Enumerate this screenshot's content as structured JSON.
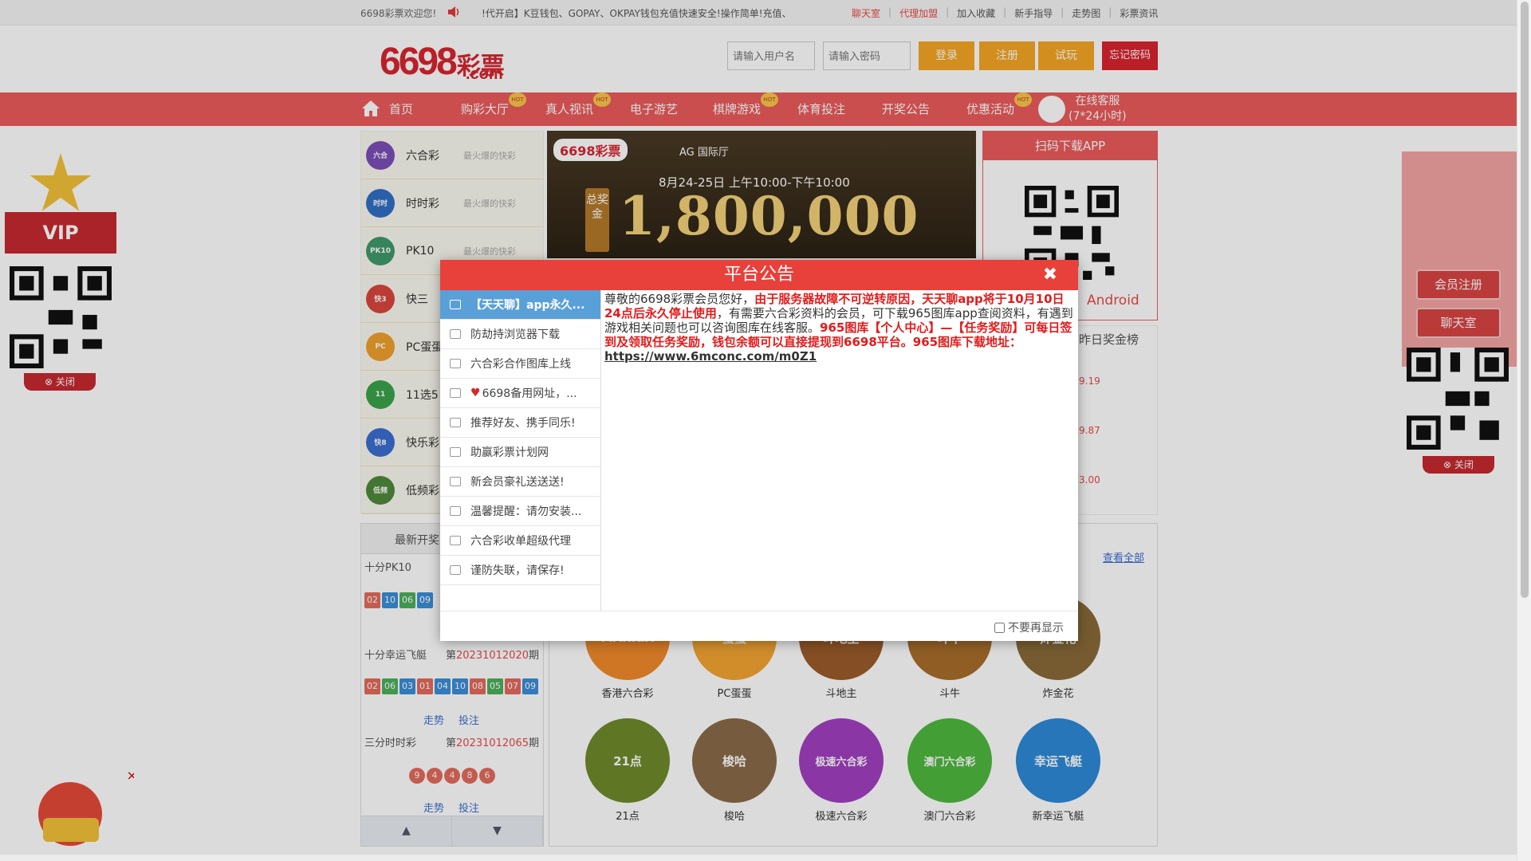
{
  "topbar": {
    "welcome": "6698彩票欢迎您!",
    "marquee": "!代开启】K豆钱包、GOPAY、OKPAY钱包充值快速安全!操作简单!充值、",
    "links": [
      "聊天室",
      "代理加盟",
      "加入收藏",
      "新手指导",
      "走势图",
      "彩票资讯"
    ]
  },
  "header": {
    "logo_number": "6698",
    "logo_text": "彩票",
    "logo_domain": ".com",
    "username_placeholder": "请输入用户名",
    "password_placeholder": "请输入密码",
    "login": "登录",
    "register": "注册",
    "trial": "试玩",
    "forgot": "忘记密码"
  },
  "nav": {
    "items": [
      "首页",
      "购彩大厅",
      "真人视讯",
      "电子游艺",
      "棋牌游戏",
      "体育投注",
      "开奖公告",
      "优惠活动"
    ],
    "hot_badge": "HOT",
    "service_line1": "在线客服",
    "service_line2": "(7*24小时)"
  },
  "lotteries": [
    {
      "name": "六合彩",
      "desc": "最火爆的快彩",
      "icon": "六合",
      "color": "#7b4fb8"
    },
    {
      "name": "时时彩",
      "desc": "最火爆的快彩",
      "icon": "时时",
      "color": "#2f6fc4"
    },
    {
      "name": "PK10",
      "desc": "最火爆的快彩",
      "icon": "PK10",
      "color": "#3f9a6a"
    },
    {
      "name": "快三",
      "desc": "",
      "icon": "快3",
      "color": "#d9463e"
    },
    {
      "name": "PC蛋蛋",
      "desc": "",
      "icon": "PC",
      "color": "#f0a12a"
    },
    {
      "name": "11选5",
      "desc": "",
      "icon": "11",
      "color": "#3aa44a"
    },
    {
      "name": "快乐彩",
      "desc": "",
      "icon": "快8",
      "color": "#3b6fd2"
    },
    {
      "name": "低频彩",
      "desc": "",
      "icon": "低频",
      "color": "#4d8a3b"
    }
  ],
  "banner": {
    "logo": "6698彩票",
    "ag": "AG 国际厅",
    "date": "8月24-25日  上午10:00-下午10:00",
    "money": "1,800,000",
    "prize_label": "总奖金"
  },
  "qr_panel": {
    "title": "扫码下载APP",
    "android": "Android"
  },
  "winners": {
    "title": "昨日奖金榜",
    "rows": [
      "9.19",
      "9.87",
      "3.00"
    ]
  },
  "draws": {
    "title": "最新开奖",
    "items": [
      {
        "name": "十分PK10",
        "issue": "",
        "balls": [
          "02",
          "10",
          "06",
          "09"
        ]
      },
      {
        "name": "十分幸运飞艇",
        "issue_prefix": "第",
        "issue": "20231012020",
        "issue_suffix": "期",
        "balls": [
          "02",
          "06",
          "03",
          "01",
          "04",
          "10",
          "08",
          "05",
          "07",
          "09"
        ]
      },
      {
        "name": "三分时时彩",
        "issue_prefix": "第",
        "issue": "20231012065",
        "issue_suffix": "期",
        "balls": [
          "9",
          "4",
          "4",
          "8",
          "6"
        ]
      }
    ],
    "trend": "走势",
    "bet": "投注",
    "up": "▲",
    "down": "▼"
  },
  "games": {
    "view_all": "查看全部",
    "items": [
      {
        "label": "香港六合彩",
        "art": "MARKIX",
        "color": "#f08a2a"
      },
      {
        "label": "PC蛋蛋",
        "art": "蛋蛋",
        "color": "#f3a531"
      },
      {
        "label": "斗地主",
        "art": "斗地主",
        "color": "#9b5b2a"
      },
      {
        "label": "斗牛",
        "art": "斗牛",
        "color": "#a86d2c"
      },
      {
        "label": "炸金花",
        "art": "炸金花",
        "color": "#8a6a3a"
      },
      {
        "label": "21点",
        "art": "21点",
        "color": "#6f8a2a"
      },
      {
        "label": "梭哈",
        "art": "梭哈",
        "color": "#8a6a4a"
      },
      {
        "label": "极速六合彩",
        "art": "极速六合彩",
        "color": "#a23fc0"
      },
      {
        "label": "澳门六合彩",
        "art": "澳门六合彩",
        "color": "#4fb83f"
      },
      {
        "label": "新幸运飞艇",
        "art": "幸运飞艇",
        "color": "#2f8ad9"
      }
    ]
  },
  "side": {
    "vip": "VIP",
    "close": "关闭",
    "member_register": "会员注册",
    "chat_room": "聊天室"
  },
  "modal": {
    "title": "平台公告",
    "close": "✖",
    "dont_show": "不要再显示",
    "list": [
      "【天天聊】app永久...",
      "防劫持浏览器下载",
      "六合彩合作图库上线",
      "6698备用网址，...",
      "推荐好友、携手同乐!",
      "助赢彩票计划网",
      "新会员豪礼送送送!",
      "温馨提醒：请勿安装...",
      "六合彩收单超级代理",
      "谨防失联，请保存!"
    ],
    "content": {
      "p1": "尊敬的6698彩票会员您好，",
      "p2": "由于服务器故障不可逆转原因，天天聊app将于10月10日24点后永久停止使用",
      "p3": "，有需要六合彩资料的会员，可下载965图库app查阅资料，有遇到游戏相关问题也可以咨询图库在线客服。",
      "p4": "965图库【个人中心】—【任务奖励】可每日签到及领取任务奖励，钱包余额可以直接提现到6698平台。965图库下载地址：",
      "link": "https://www.6mconc.com/m0Z1"
    }
  }
}
